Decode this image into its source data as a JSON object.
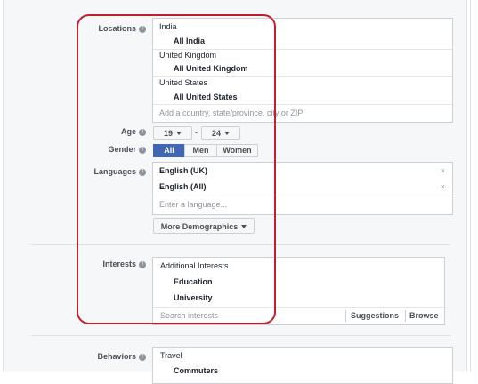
{
  "locations": {
    "label": "Locations",
    "entries": [
      {
        "country": "India",
        "scope": "All India"
      },
      {
        "country": "United Kingdom",
        "scope": "All United Kingdom"
      },
      {
        "country": "United States",
        "scope": "All United States"
      }
    ],
    "placeholder": "Add a country, state/province, city or ZIP"
  },
  "age": {
    "label": "Age",
    "min": "19",
    "dash": "-",
    "max": "24"
  },
  "gender": {
    "label": "Gender",
    "options": [
      "All",
      "Men",
      "Women"
    ],
    "selected": "All"
  },
  "languages": {
    "label": "Languages",
    "items": [
      "English (UK)",
      "English (All)"
    ],
    "remove": "×",
    "placeholder": "Enter a language..."
  },
  "more_demographics": "More Demographics",
  "interests": {
    "label": "Interests",
    "header": "Additional Interests",
    "items": [
      "Education",
      "University"
    ],
    "placeholder": "Search interests",
    "suggestions": "Suggestions",
    "browse": "Browse"
  },
  "behaviors": {
    "label": "Behaviors",
    "header": "Travel",
    "items": [
      "Commuters"
    ]
  },
  "colors": {
    "accent": "#4267b2",
    "highlight": "#c0202b"
  }
}
